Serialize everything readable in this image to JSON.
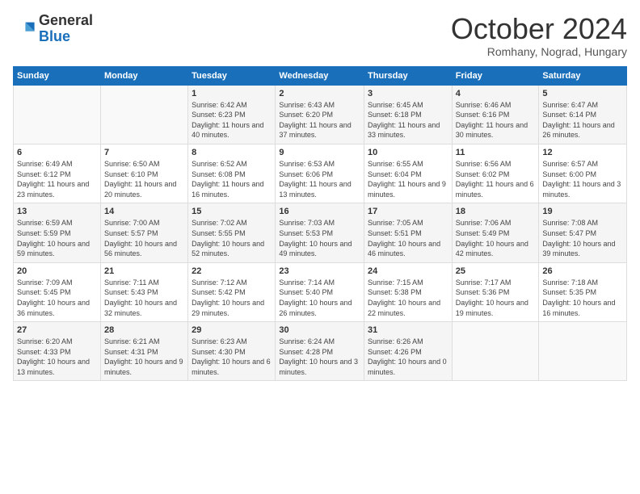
{
  "logo": {
    "general": "General",
    "blue": "Blue"
  },
  "header": {
    "month": "October 2024",
    "location": "Romhany, Nograd, Hungary"
  },
  "weekdays": [
    "Sunday",
    "Monday",
    "Tuesday",
    "Wednesday",
    "Thursday",
    "Friday",
    "Saturday"
  ],
  "weeks": [
    [
      {
        "day": "",
        "info": ""
      },
      {
        "day": "",
        "info": ""
      },
      {
        "day": "1",
        "info": "Sunrise: 6:42 AM\nSunset: 6:23 PM\nDaylight: 11 hours and 40 minutes."
      },
      {
        "day": "2",
        "info": "Sunrise: 6:43 AM\nSunset: 6:20 PM\nDaylight: 11 hours and 37 minutes."
      },
      {
        "day": "3",
        "info": "Sunrise: 6:45 AM\nSunset: 6:18 PM\nDaylight: 11 hours and 33 minutes."
      },
      {
        "day": "4",
        "info": "Sunrise: 6:46 AM\nSunset: 6:16 PM\nDaylight: 11 hours and 30 minutes."
      },
      {
        "day": "5",
        "info": "Sunrise: 6:47 AM\nSunset: 6:14 PM\nDaylight: 11 hours and 26 minutes."
      }
    ],
    [
      {
        "day": "6",
        "info": "Sunrise: 6:49 AM\nSunset: 6:12 PM\nDaylight: 11 hours and 23 minutes."
      },
      {
        "day": "7",
        "info": "Sunrise: 6:50 AM\nSunset: 6:10 PM\nDaylight: 11 hours and 20 minutes."
      },
      {
        "day": "8",
        "info": "Sunrise: 6:52 AM\nSunset: 6:08 PM\nDaylight: 11 hours and 16 minutes."
      },
      {
        "day": "9",
        "info": "Sunrise: 6:53 AM\nSunset: 6:06 PM\nDaylight: 11 hours and 13 minutes."
      },
      {
        "day": "10",
        "info": "Sunrise: 6:55 AM\nSunset: 6:04 PM\nDaylight: 11 hours and 9 minutes."
      },
      {
        "day": "11",
        "info": "Sunrise: 6:56 AM\nSunset: 6:02 PM\nDaylight: 11 hours and 6 minutes."
      },
      {
        "day": "12",
        "info": "Sunrise: 6:57 AM\nSunset: 6:00 PM\nDaylight: 11 hours and 3 minutes."
      }
    ],
    [
      {
        "day": "13",
        "info": "Sunrise: 6:59 AM\nSunset: 5:59 PM\nDaylight: 10 hours and 59 minutes."
      },
      {
        "day": "14",
        "info": "Sunrise: 7:00 AM\nSunset: 5:57 PM\nDaylight: 10 hours and 56 minutes."
      },
      {
        "day": "15",
        "info": "Sunrise: 7:02 AM\nSunset: 5:55 PM\nDaylight: 10 hours and 52 minutes."
      },
      {
        "day": "16",
        "info": "Sunrise: 7:03 AM\nSunset: 5:53 PM\nDaylight: 10 hours and 49 minutes."
      },
      {
        "day": "17",
        "info": "Sunrise: 7:05 AM\nSunset: 5:51 PM\nDaylight: 10 hours and 46 minutes."
      },
      {
        "day": "18",
        "info": "Sunrise: 7:06 AM\nSunset: 5:49 PM\nDaylight: 10 hours and 42 minutes."
      },
      {
        "day": "19",
        "info": "Sunrise: 7:08 AM\nSunset: 5:47 PM\nDaylight: 10 hours and 39 minutes."
      }
    ],
    [
      {
        "day": "20",
        "info": "Sunrise: 7:09 AM\nSunset: 5:45 PM\nDaylight: 10 hours and 36 minutes."
      },
      {
        "day": "21",
        "info": "Sunrise: 7:11 AM\nSunset: 5:43 PM\nDaylight: 10 hours and 32 minutes."
      },
      {
        "day": "22",
        "info": "Sunrise: 7:12 AM\nSunset: 5:42 PM\nDaylight: 10 hours and 29 minutes."
      },
      {
        "day": "23",
        "info": "Sunrise: 7:14 AM\nSunset: 5:40 PM\nDaylight: 10 hours and 26 minutes."
      },
      {
        "day": "24",
        "info": "Sunrise: 7:15 AM\nSunset: 5:38 PM\nDaylight: 10 hours and 22 minutes."
      },
      {
        "day": "25",
        "info": "Sunrise: 7:17 AM\nSunset: 5:36 PM\nDaylight: 10 hours and 19 minutes."
      },
      {
        "day": "26",
        "info": "Sunrise: 7:18 AM\nSunset: 5:35 PM\nDaylight: 10 hours and 16 minutes."
      }
    ],
    [
      {
        "day": "27",
        "info": "Sunrise: 6:20 AM\nSunset: 4:33 PM\nDaylight: 10 hours and 13 minutes."
      },
      {
        "day": "28",
        "info": "Sunrise: 6:21 AM\nSunset: 4:31 PM\nDaylight: 10 hours and 9 minutes."
      },
      {
        "day": "29",
        "info": "Sunrise: 6:23 AM\nSunset: 4:30 PM\nDaylight: 10 hours and 6 minutes."
      },
      {
        "day": "30",
        "info": "Sunrise: 6:24 AM\nSunset: 4:28 PM\nDaylight: 10 hours and 3 minutes."
      },
      {
        "day": "31",
        "info": "Sunrise: 6:26 AM\nSunset: 4:26 PM\nDaylight: 10 hours and 0 minutes."
      },
      {
        "day": "",
        "info": ""
      },
      {
        "day": "",
        "info": ""
      }
    ]
  ]
}
